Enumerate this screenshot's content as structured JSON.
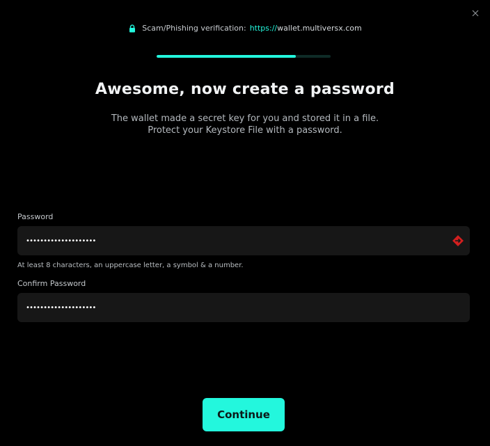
{
  "window": {
    "close_icon": "close-icon"
  },
  "verification": {
    "icon": "lock-icon",
    "label": "Scam/Phishing verification:",
    "protocol": "https://",
    "host": "wallet.multiversx.com"
  },
  "progress": {
    "fraction": 0.8,
    "fill_color": "#23f7dd",
    "track_color": "#0e2b27"
  },
  "header": {
    "title": "Awesome, now create a password",
    "subtitle_line1": "The wallet made a secret key for you and stored it in a file.",
    "subtitle_line2": "Protect your Keystore File with a password."
  },
  "form": {
    "password_label": "Password",
    "password_value": "••••••••••••••••••••",
    "password_manager_icon": "password-manager-icon",
    "password_hint": "At least 8 characters, an uppercase letter, a symbol & a number.",
    "confirm_label": "Confirm Password",
    "confirm_value": "••••••••••••••••••••"
  },
  "actions": {
    "continue_label": "Continue",
    "accent_color": "#23f7dd"
  }
}
